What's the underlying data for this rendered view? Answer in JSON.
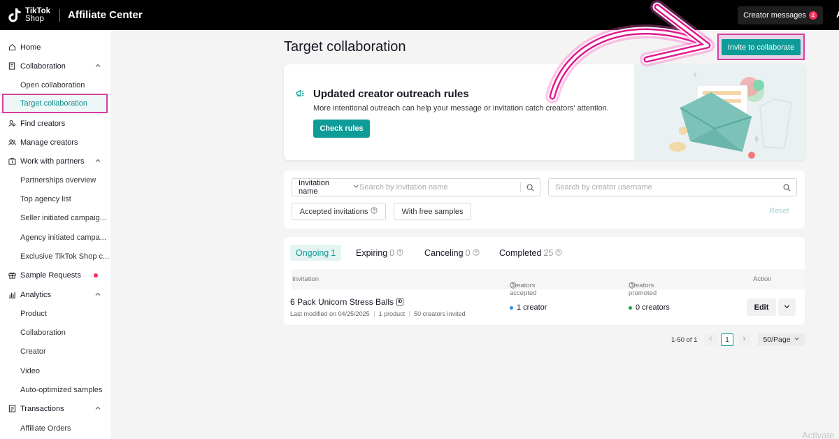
{
  "topbar": {
    "brand_line1": "TikTok",
    "brand_line2": "Shop",
    "app_title": "Affiliate Center",
    "creator_messages_label": "Creator messages",
    "creator_messages_count": "4",
    "avatar_letter": "A"
  },
  "sidebar": {
    "home": "Home",
    "collaboration": "Collaboration",
    "open_collaboration": "Open collaboration",
    "target_collaboration": "Target collaboration",
    "find_creators": "Find creators",
    "manage_creators": "Manage creators",
    "work_with_partners": "Work with partners",
    "partnerships_overview": "Partnerships overview",
    "top_agency_list": "Top agency list",
    "seller_initiated": "Seller initiated campaig...",
    "agency_initiated": "Agency initiated campa...",
    "exclusive": "Exclusive TikTok Shop c...",
    "sample_requests": "Sample Requests",
    "analytics": "Analytics",
    "product": "Product",
    "analytics_collaboration": "Collaboration",
    "creator": "Creator",
    "video": "Video",
    "auto_optimized": "Auto-optimized samples",
    "transactions": "Transactions",
    "affiliate_orders": "Affiliate Orders"
  },
  "main": {
    "page_title": "Target collaboration",
    "invite_button": "Invite to collaborate",
    "banner": {
      "title": "Updated creator outreach rules",
      "description": "More intentional outreach can help your message or invitation catch creators' attention.",
      "button": "Check rules"
    },
    "filters": {
      "invitation_select": "Invitation name",
      "invitation_placeholder": "Search by invitation name",
      "creator_placeholder": "Search by creator username",
      "accepted_invitations": "Accepted invitations",
      "with_free_samples": "With free samples",
      "reset": "Reset"
    },
    "tabs": [
      {
        "label": "Ongoing",
        "count": "1"
      },
      {
        "label": "Expiring",
        "count": "0"
      },
      {
        "label": "Canceling",
        "count": "0"
      },
      {
        "label": "Completed",
        "count": "25"
      }
    ],
    "table": {
      "headers": {
        "invitation": "Invitation",
        "creators_accepted": "Creators accepted",
        "creators_promoted": "Creators promoted",
        "action": "Action"
      },
      "rows": [
        {
          "title": "6 Pack Unicorn Stress Balls",
          "id_badge": "ID",
          "modified": "Last modified on 04/25/2025",
          "products": "1 product",
          "invited": "50 creators invited",
          "accepted": "1 creator",
          "promoted": "0 creators",
          "edit": "Edit"
        }
      ]
    },
    "pagination": {
      "range": "1-50 of 1",
      "current_page": "1",
      "per_page": "50/Page"
    }
  },
  "watermark": "Activate",
  "colors": {
    "accent": "#0e9c98",
    "highlight": "#d63fa0",
    "badge": "#fe2c55",
    "accepted_dot": "#2e8fe6",
    "promoted_dot": "#22a447"
  },
  "icons": [
    "home-icon",
    "collaboration-icon",
    "find-creators-icon",
    "manage-creators-icon",
    "partners-icon",
    "gift-icon",
    "analytics-icon",
    "transactions-icon",
    "chevron-up-icon",
    "search-icon",
    "help-icon",
    "chevron-down-icon",
    "chevron-left-icon",
    "chevron-right-icon",
    "megaphone-icon",
    "pink-arrow"
  ]
}
